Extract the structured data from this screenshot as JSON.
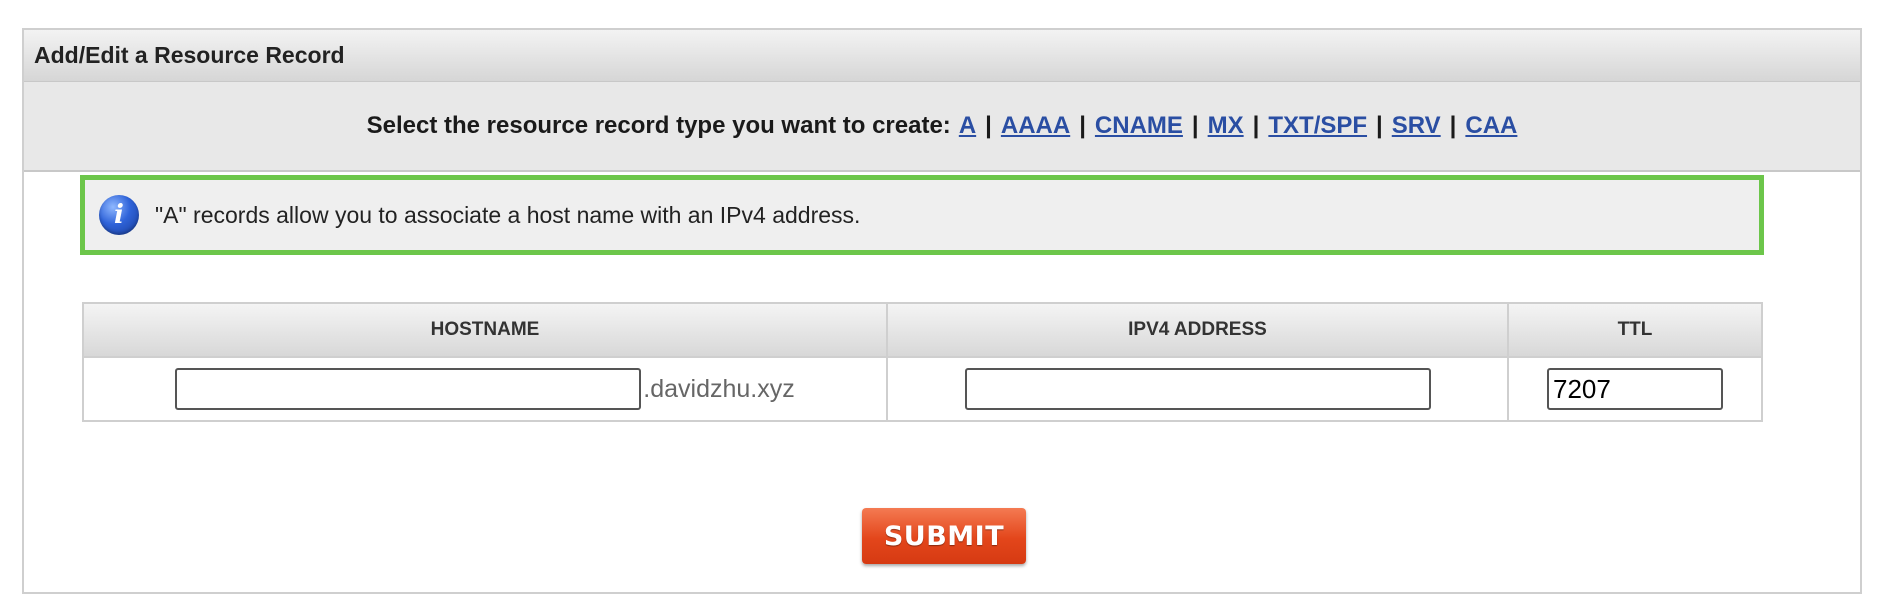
{
  "panel": {
    "title": "Add/Edit a Resource Record"
  },
  "type_selector": {
    "prompt": "Select the resource record type you want to create:",
    "types": [
      "A",
      "AAAA",
      "CNAME",
      "MX",
      "TXT/SPF",
      "SRV",
      "CAA"
    ],
    "separator": "|",
    "link_color": "#2a4ea3"
  },
  "info": {
    "icon": "info-icon",
    "message": "\"A\" records allow you to associate a host name with an IPv4 address.",
    "border_color": "#6cc64a"
  },
  "table": {
    "headers": {
      "hostname": "HOSTNAME",
      "ipv4": "IPV4 ADDRESS",
      "ttl": "TTL"
    },
    "row": {
      "hostname_value": "",
      "domain_suffix": ".davidzhu.xyz",
      "ipv4_value": "",
      "ttl_value": "7207"
    }
  },
  "submit": {
    "label": "SUBMIT",
    "color": "#e3461b"
  }
}
